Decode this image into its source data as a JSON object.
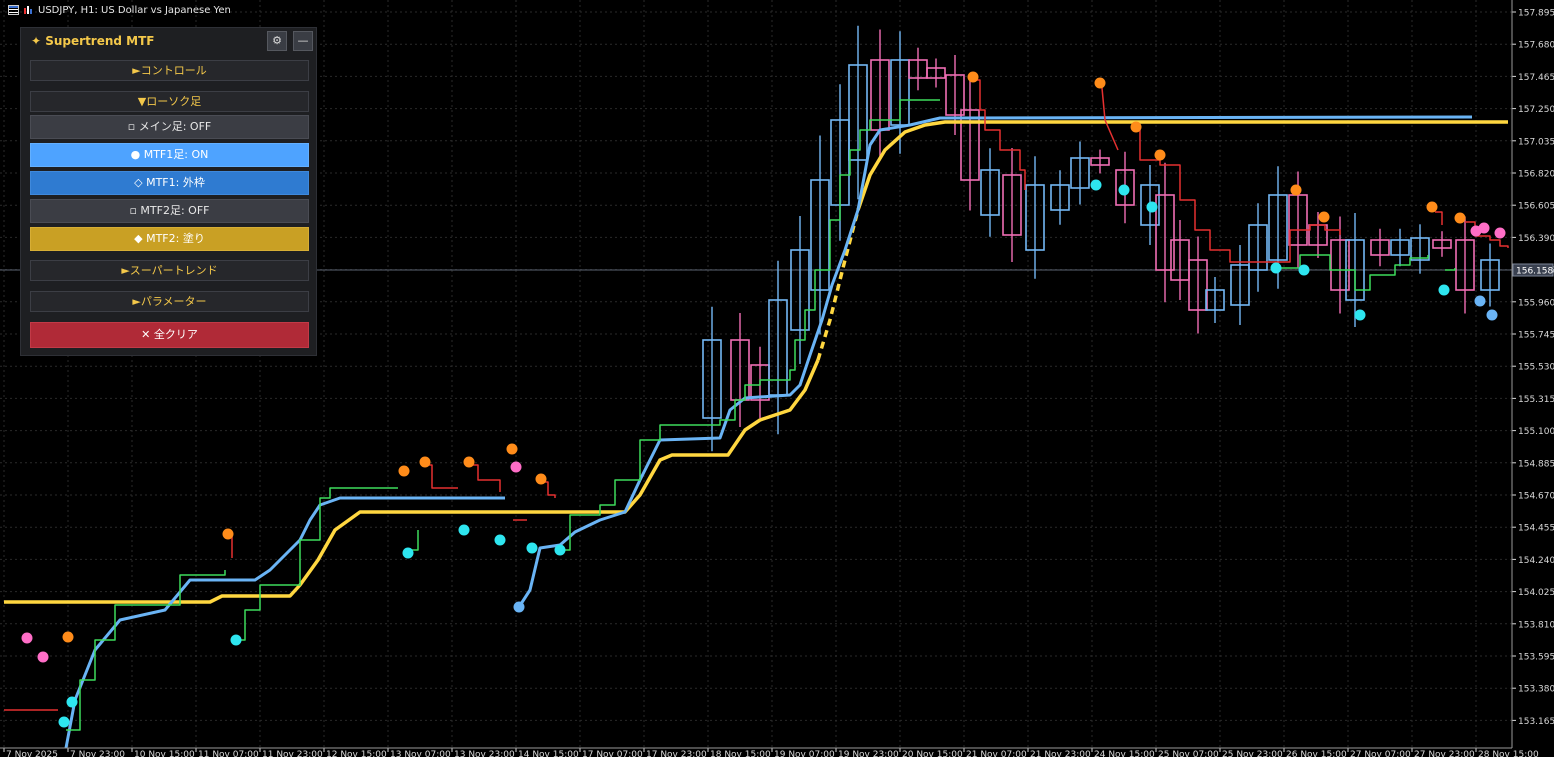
{
  "window": {
    "title": "USDJPY, H1:  US Dollar vs Japanese Yen"
  },
  "panel": {
    "title": "✦ Supertrend MTF",
    "gear_icon": "⚙",
    "minimize_label": "—",
    "sections": {
      "control": "►コントロール",
      "candles": "▼ローソク足",
      "supertrend": "►スーパートレンド",
      "params": "►パラメーター"
    },
    "buttons": {
      "main_candle": "▫ メイン足: OFF",
      "mtf1_candle": "● MTF1足: ON",
      "mtf1_style": "◇ MTF1: 外枠",
      "mtf2_candle": "▫ MTF2足: OFF",
      "mtf2_style": "◆ MTF2: 塗り",
      "clear_all": "✕ 全クリア"
    }
  },
  "price_axis": {
    "labels": [
      "157.895",
      "157.680",
      "157.465",
      "157.250",
      "157.035",
      "156.820",
      "156.605",
      "156.390",
      "156.175",
      "155.960",
      "155.745",
      "155.530",
      "155.315",
      "155.100",
      "154.885",
      "154.670",
      "154.455",
      "154.240",
      "154.025",
      "153.810",
      "153.595",
      "153.380",
      "153.165"
    ],
    "current_price": "156.158"
  },
  "time_axis": {
    "labels": [
      "7 Nov 2025",
      "7 Nov 23:00",
      "10 Nov 15:00",
      "11 Nov 07:00",
      "11 Nov 23:00",
      "12 Nov 15:00",
      "13 Nov 07:00",
      "13 Nov 23:00",
      "14 Nov 15:00",
      "17 Nov 07:00",
      "17 Nov 23:00",
      "18 Nov 15:00",
      "19 Nov 07:00",
      "19 Nov 23:00",
      "20 Nov 15:00",
      "21 Nov 07:00",
      "21 Nov 23:00",
      "24 Nov 15:00",
      "25 Nov 07:00",
      "25 Nov 23:00",
      "26 Nov 15:00",
      "27 Nov 07:00",
      "27 Nov 23:00",
      "28 Nov 15:00"
    ]
  },
  "colors": {
    "background": "#000000",
    "grid": "#2a2a2a",
    "axis_text": "#d8d8d8",
    "supertrend_htf": "#ffd740",
    "supertrend_mtf": "#6ab4f5",
    "supertrend_bull": "#3ddc5c",
    "supertrend_bear": "#e53030",
    "candle_bull": "#74b8f5",
    "candle_bear": "#f06eb4",
    "signal_up": "#2ee6f0",
    "signal_down": "#ff8c1a",
    "signal_pink": "#ff6ec7",
    "current_price_line": "#5a6270"
  }
}
